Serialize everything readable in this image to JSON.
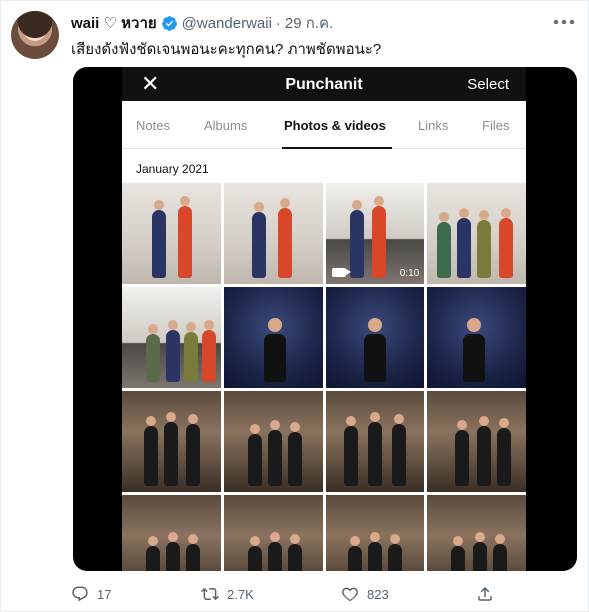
{
  "tweet": {
    "display_name": "waii ♡ หวาย",
    "handle": "@wanderwaii",
    "separator": "·",
    "date": "29 ก.ค.",
    "text": "เสียงดังฟังชัดเจนพอนะคะทุกคน? ภาพชัดพอนะ?",
    "verified": true,
    "icons": {
      "more": "more-icon",
      "verified": "verified-badge-icon",
      "reply": "reply-icon",
      "retweet": "retweet-icon",
      "like": "like-icon",
      "share": "share-icon"
    },
    "colors": {
      "verified": "#1d9bf0",
      "muted": "#536471"
    }
  },
  "media": {
    "top_bar": {
      "close_glyph": "✕",
      "title": "Punchanit",
      "select_label": "Select"
    },
    "tabs": [
      {
        "label": "Notes"
      },
      {
        "label": "Albums"
      },
      {
        "label": "Photos & videos",
        "active": true
      },
      {
        "label": "Links"
      },
      {
        "label": "Files"
      }
    ],
    "section_label": "January 2021",
    "video_duration": "0:10"
  },
  "actions": {
    "replies": "17",
    "retweets": "2.7K",
    "likes": "823"
  }
}
